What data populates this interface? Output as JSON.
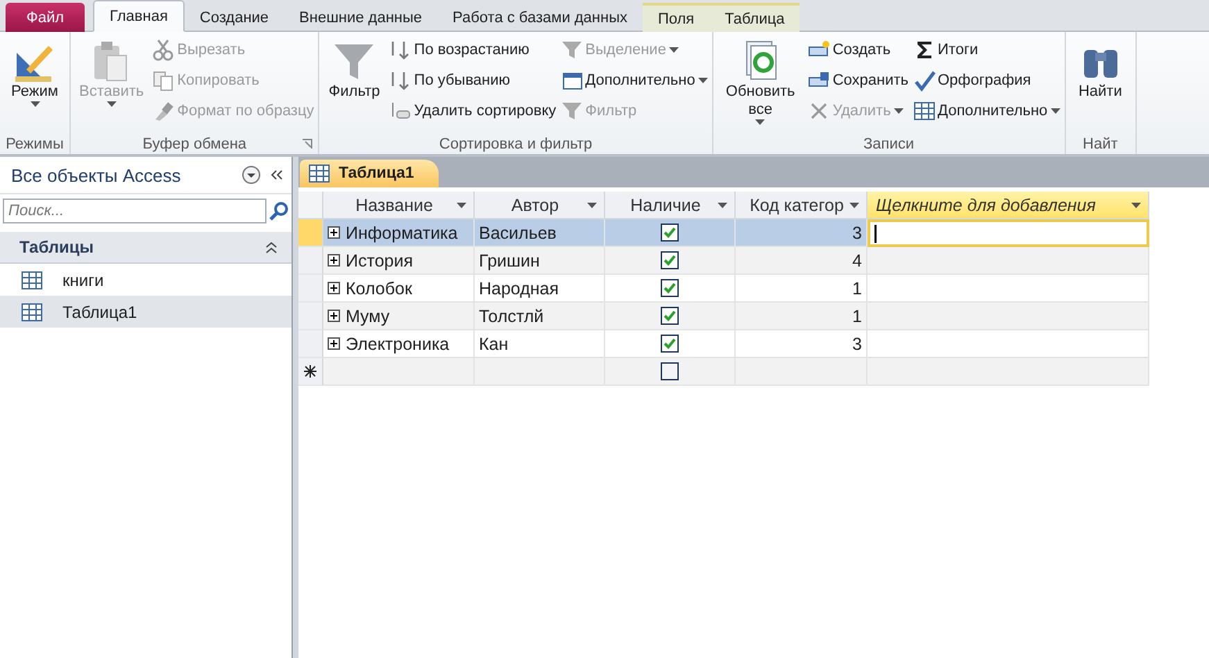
{
  "ribbon_tabs": [
    {
      "label": "Файл",
      "kind": "file",
      "selected": false
    },
    {
      "label": "Главная",
      "kind": "normal",
      "selected": true
    },
    {
      "label": "Создание",
      "kind": "normal",
      "selected": false
    },
    {
      "label": "Внешние данные",
      "kind": "normal",
      "selected": false
    },
    {
      "label": "Работа с базами данных",
      "kind": "normal",
      "selected": false
    },
    {
      "label": "Поля",
      "kind": "contextual",
      "selected": false
    },
    {
      "label": "Таблица",
      "kind": "contextual",
      "selected": false
    }
  ],
  "ribbon_groups": [
    {
      "label": "Режимы",
      "items": [
        {
          "kind": "large",
          "label": "Режим",
          "disabled": false,
          "dropdown": true
        }
      ]
    },
    {
      "label": "Буфер обмена",
      "launcher": true,
      "items": [
        {
          "kind": "large",
          "label": "Вставить",
          "disabled": true,
          "dropdown": true
        },
        {
          "kind": "small",
          "label": "Вырезать",
          "disabled": true,
          "dropdown": false
        },
        {
          "kind": "small",
          "label": "Копировать",
          "disabled": true,
          "dropdown": false
        },
        {
          "kind": "small",
          "label": "Формат по образцу",
          "disabled": true,
          "dropdown": false
        }
      ]
    },
    {
      "label": "Сортировка и фильтр",
      "items": [
        {
          "kind": "large",
          "label": "Фильтр",
          "disabled": false,
          "dropdown": false
        },
        {
          "kind": "small",
          "label": "По возрастанию",
          "disabled": false,
          "dropdown": false
        },
        {
          "kind": "small",
          "label": "По убыванию",
          "disabled": false,
          "dropdown": false
        },
        {
          "kind": "small",
          "label": "Удалить сортировку",
          "disabled": false,
          "dropdown": false
        },
        {
          "kind": "small",
          "label": "Выделение",
          "disabled": true,
          "dropdown": true
        },
        {
          "kind": "small",
          "label": "Дополнительно",
          "disabled": false,
          "dropdown": true
        },
        {
          "kind": "small",
          "label": "Фильтр",
          "disabled": true,
          "dropdown": false
        }
      ]
    },
    {
      "label": "Записи",
      "items": [
        {
          "kind": "large",
          "label": "Обновить все",
          "disabled": false,
          "dropdown": true
        },
        {
          "kind": "small",
          "label": "Создать",
          "disabled": false,
          "dropdown": false
        },
        {
          "kind": "small",
          "label": "Сохранить",
          "disabled": false,
          "dropdown": false
        },
        {
          "kind": "small",
          "label": "Удалить",
          "disabled": true,
          "dropdown": true
        },
        {
          "kind": "small",
          "label": "Итоги",
          "disabled": false,
          "dropdown": false
        },
        {
          "kind": "small",
          "label": "Орфография",
          "disabled": false,
          "dropdown": false
        },
        {
          "kind": "small",
          "label": "Дополнительно",
          "disabled": false,
          "dropdown": true
        }
      ]
    },
    {
      "label": "Найт",
      "items": [
        {
          "kind": "large",
          "label": "Найти",
          "disabled": false,
          "dropdown": false
        }
      ]
    }
  ],
  "navigation": {
    "title": "Все объекты Access",
    "search": {
      "placeholder": "Поиск..."
    },
    "group": {
      "label": "Таблицы",
      "expanded": true
    },
    "items": [
      {
        "label": "книги",
        "selected": false
      },
      {
        "label": "Таблица1",
        "selected": true
      }
    ]
  },
  "document_tab": {
    "label": "Таблица1"
  },
  "table": {
    "columns": [
      {
        "label": "Название",
        "kind": "text"
      },
      {
        "label": "Автор",
        "kind": "text"
      },
      {
        "label": "Наличие",
        "kind": "check"
      },
      {
        "label": "Код категор",
        "kind": "number"
      },
      {
        "label": "Щелкните для добавления",
        "kind": "add"
      }
    ],
    "rows": [
      {
        "kind": "record",
        "selected": true,
        "title": "Информатика",
        "author": "Васильев",
        "available": true,
        "category": "3"
      },
      {
        "kind": "record",
        "selected": false,
        "title": "История",
        "author": "Гришин",
        "available": true,
        "category": "4"
      },
      {
        "kind": "record",
        "selected": false,
        "title": "Колобок",
        "author": "Народная",
        "available": true,
        "category": "1"
      },
      {
        "kind": "record",
        "selected": false,
        "title": "Муму",
        "author": "Толстлй",
        "available": true,
        "category": "1"
      },
      {
        "kind": "record",
        "selected": false,
        "title": "Электроника",
        "author": "Кан",
        "available": true,
        "category": "3"
      },
      {
        "kind": "new",
        "selected": false,
        "available": false
      }
    ]
  }
}
